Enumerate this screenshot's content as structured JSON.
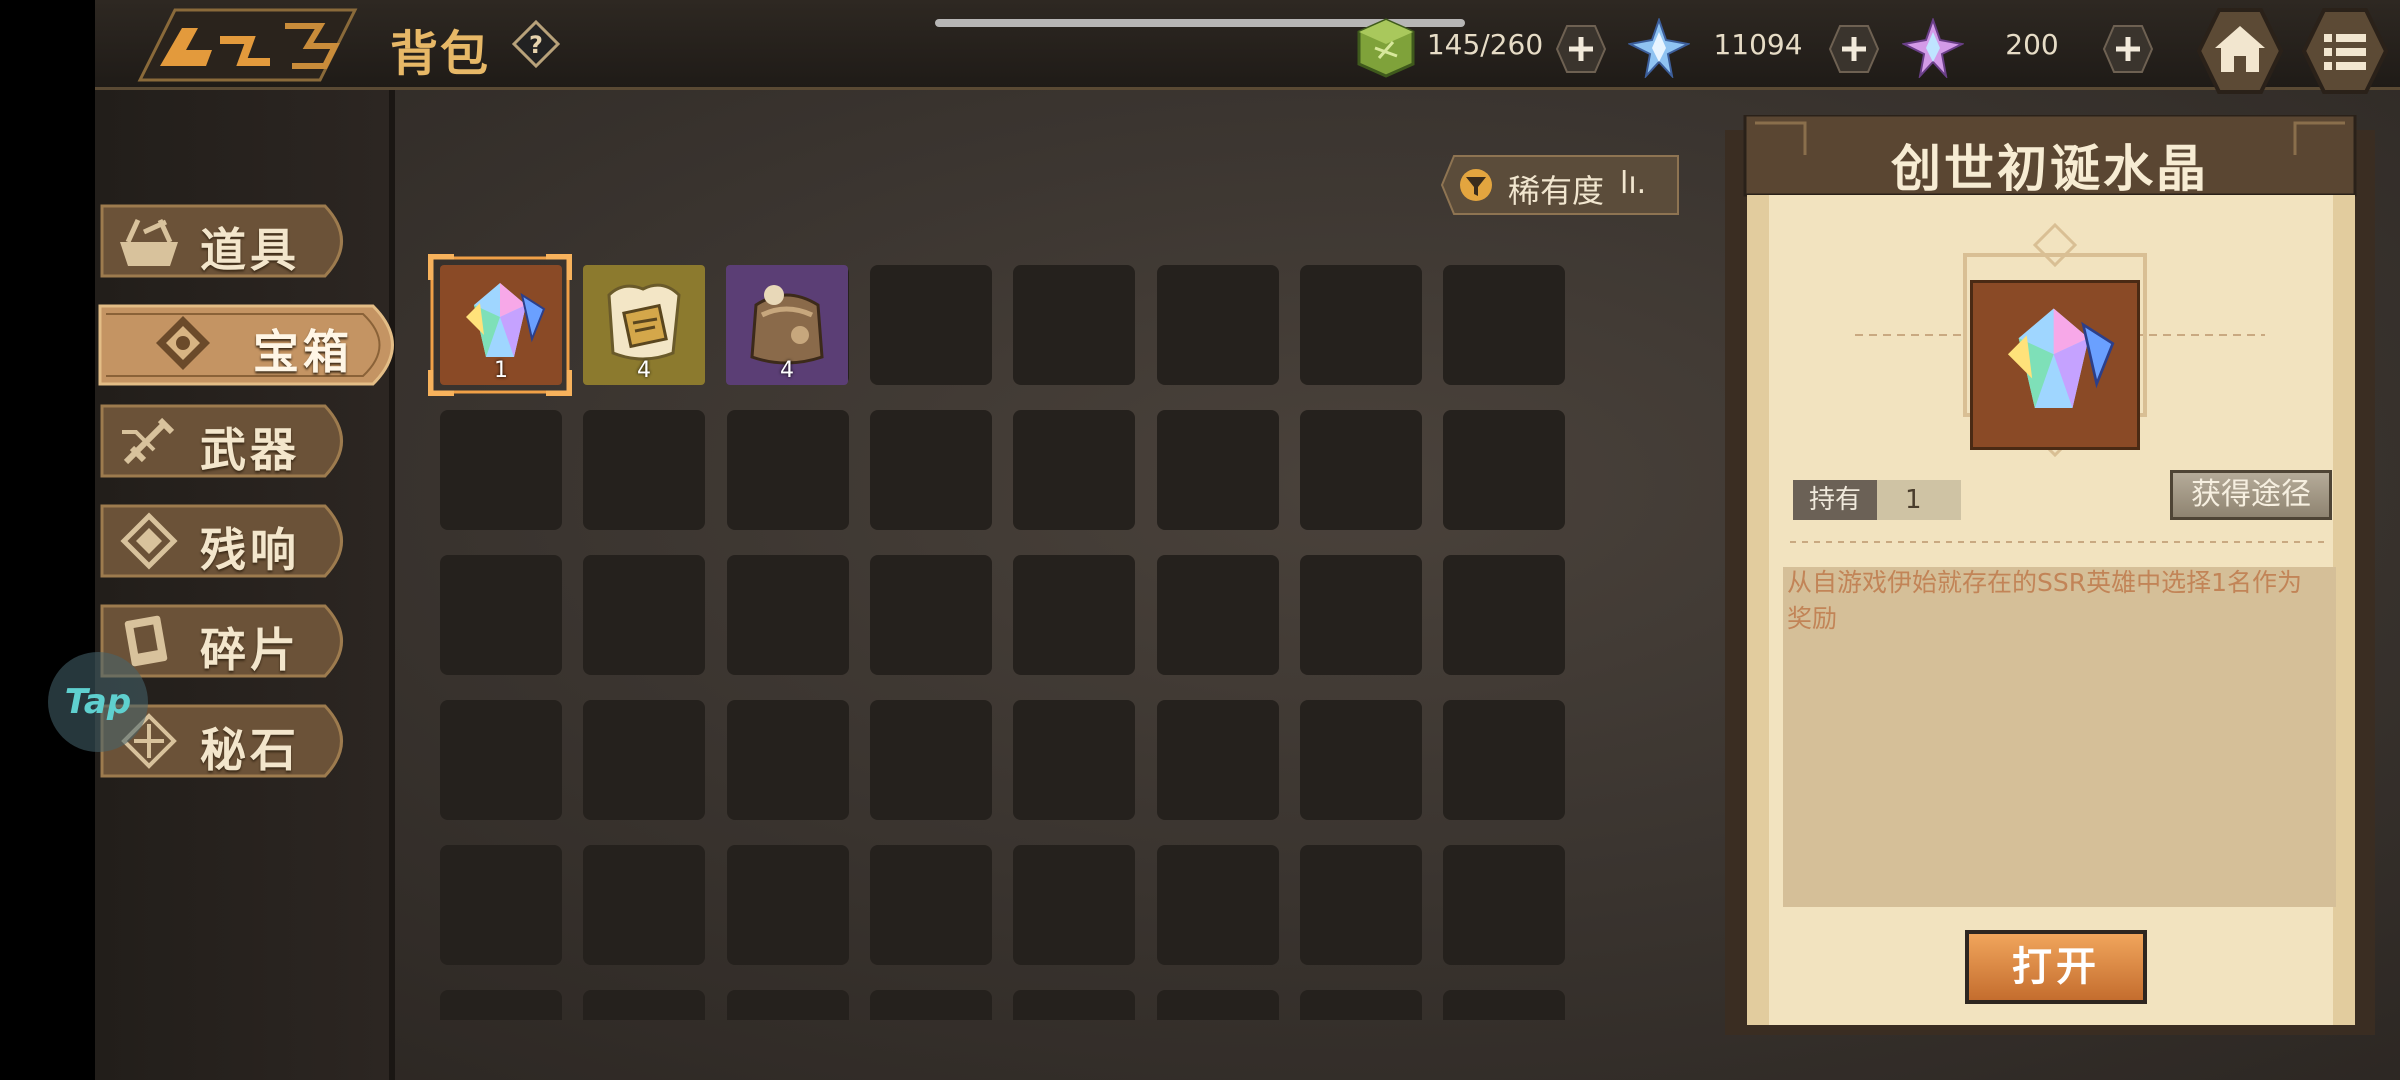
{
  "header": {
    "title": "背包",
    "help_icon": "question-diamond-icon"
  },
  "resources": [
    {
      "name": "stamina",
      "icon": "green-cube-icon",
      "value": "145/260"
    },
    {
      "name": "crystal",
      "icon": "blue-crystal-icon",
      "value": "11094"
    },
    {
      "name": "premium-crystal",
      "icon": "pink-crystal-icon",
      "value": "200"
    }
  ],
  "nav": {
    "tabs": [
      {
        "label": "道具",
        "icon": "basket-icon"
      },
      {
        "label": "宝箱",
        "icon": "chest-emblem-icon",
        "active": true
      },
      {
        "label": "武器",
        "icon": "sword-icon"
      },
      {
        "label": "残响",
        "icon": "echo-icon"
      },
      {
        "label": "碎片",
        "icon": "card-icon"
      },
      {
        "label": "秘石",
        "icon": "runestone-icon"
      }
    ]
  },
  "tap_button": "Tap",
  "filter": {
    "label": "稀有度",
    "sort_glyph": "lı."
  },
  "inventory": {
    "items": [
      {
        "name": "genesis-crystal",
        "count": "1",
        "selected": true,
        "rarity_color": "#8a4a26"
      },
      {
        "name": "golden-scroll-box",
        "count": "4",
        "rarity_color": "#8c7a2e"
      },
      {
        "name": "leather-pack",
        "count": "4",
        "rarity_color": "#5b3e75"
      }
    ]
  },
  "detail": {
    "title": "创世初诞水晶",
    "hold_label": "持有",
    "hold_value": "1",
    "source_button": "获得途径",
    "description": "从自游戏伊始就存在的SSR英雄中选择1名作为奖励",
    "open_button": "打开"
  },
  "colors": {
    "accent_gold": "#e7b867",
    "panel_paper": "#f2e3bf",
    "open_orange": "#e08a41"
  }
}
